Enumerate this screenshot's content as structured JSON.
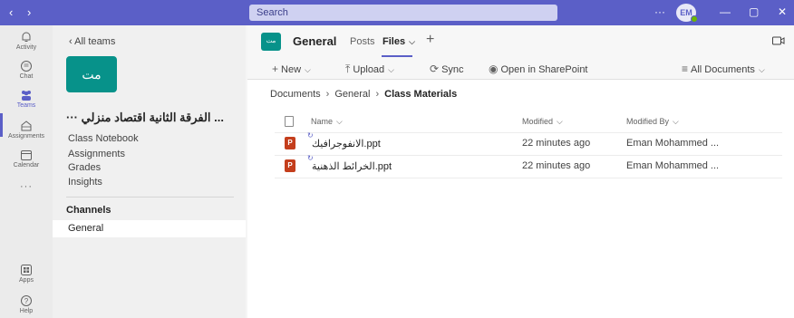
{
  "titlebar": {
    "nav_label": "‹ ›",
    "search_placeholder": "Search",
    "more_label": "···",
    "avatar_initials": "EM",
    "minimize_label": "—",
    "maximize_label": "▢",
    "close_label": "✕"
  },
  "rail": {
    "items": [
      {
        "label": "Activity",
        "icon": "bell-icon"
      },
      {
        "label": "Chat",
        "icon": "chat-icon"
      },
      {
        "label": "Teams",
        "icon": "teams-icon"
      },
      {
        "label": "Assignments",
        "icon": "assignments-icon"
      },
      {
        "label": "Calendar",
        "icon": "calendar-icon"
      },
      {
        "label": "···",
        "icon": "more-icon"
      },
      {
        "label": "Apps",
        "icon": "apps-icon"
      },
      {
        "label": "Help",
        "icon": "help-icon"
      }
    ]
  },
  "teamspane": {
    "back_label": "‹  All teams",
    "team_tile": "مت",
    "team_name": "··· الفرقة الثانية اقتصاد منزلي ...",
    "links": [
      "Class Notebook",
      "Assignments",
      "Grades",
      "Insights"
    ],
    "channels_heading": "Channels",
    "channels": [
      "General"
    ]
  },
  "main": {
    "channel_tile": "مت",
    "channel_title": "General",
    "tabs": {
      "posts": "Posts",
      "files": "Files"
    },
    "toolbar": {
      "new": "New",
      "upload": "Upload",
      "sync": "Sync",
      "sharepoint": "Open in SharePoint",
      "view": "All Documents"
    },
    "breadcrumb": [
      "Documents",
      "General",
      "Class Materials"
    ],
    "columns": {
      "name": "Name",
      "modified": "Modified",
      "modified_by": "Modified By"
    },
    "files": [
      {
        "name": "الانفوجرافيك.ppt",
        "modified": "22 minutes ago",
        "modified_by": "Eman Mohammed ..."
      },
      {
        "name": "الخرائط الذهنية.ppt",
        "modified": "22 minutes ago",
        "modified_by": "Eman Mohammed ..."
      }
    ],
    "file_icon_label": "P"
  },
  "colors": {
    "accent": "#5b5fc7",
    "team": "#07928a",
    "ppt": "#c43e1c"
  }
}
